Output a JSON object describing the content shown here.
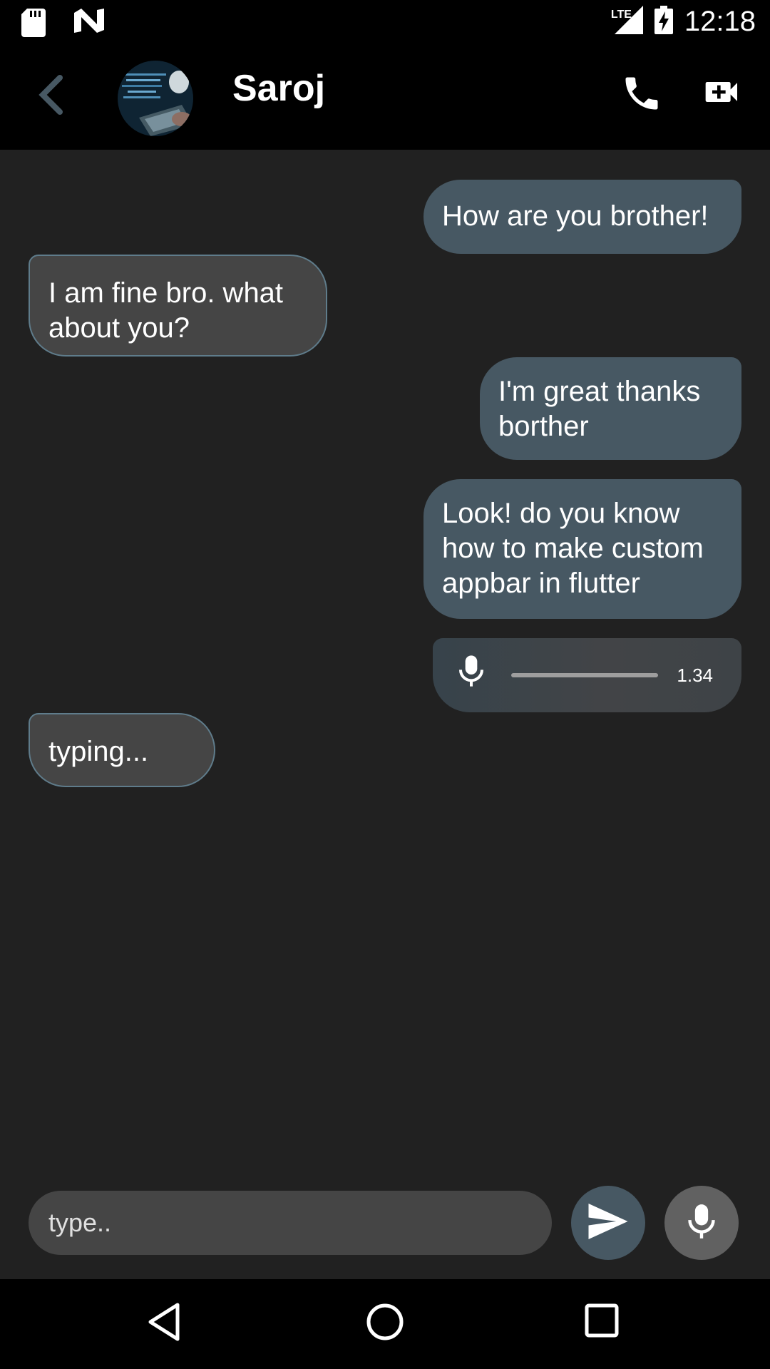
{
  "status_bar": {
    "time": "12:18",
    "network": "LTE",
    "icons": [
      "sd-card-icon",
      "n-logo-icon",
      "signal-icon",
      "battery-charging-icon"
    ]
  },
  "app_bar": {
    "contact_name": "Saroj",
    "icons": [
      "back-arrow-icon",
      "phone-icon",
      "video-call-icon"
    ]
  },
  "messages": [
    {
      "direction": "outgoing",
      "text": "How are you brother!"
    },
    {
      "direction": "incoming",
      "text": "I am fine bro. what about you?"
    },
    {
      "direction": "outgoing",
      "text": "I'm great thanks borther"
    },
    {
      "direction": "outgoing",
      "text": "Look! do you know how to make custom appbar in flutter"
    },
    {
      "direction": "outgoing",
      "type": "voice",
      "duration": "1.34"
    },
    {
      "direction": "incoming",
      "text": "typing..."
    }
  ],
  "composer": {
    "placeholder": "type..",
    "icons": [
      "send-icon",
      "microphone-icon"
    ]
  },
  "colors": {
    "background": "#212121",
    "bars": "#000000",
    "outgoing_bubble": "#475863",
    "incoming_bubble": "#454545",
    "incoming_border": "#5f7c8b",
    "mic_button": "#616161"
  }
}
